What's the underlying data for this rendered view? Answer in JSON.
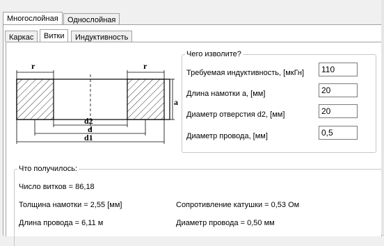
{
  "tabs_outer": [
    "Многослойная",
    "Однослойная"
  ],
  "tabs_inner": [
    "Каркас",
    "Витки",
    "Индуктивность"
  ],
  "input_group": {
    "legend": "Чего изволите?",
    "fields": [
      {
        "label": "Требуемая индуктивность, [мкГн]",
        "value": "110"
      },
      {
        "label": "Длина намотки a, [мм]",
        "value": "20"
      },
      {
        "label": "Диаметр отверстия d2, [мм]",
        "value": "20"
      },
      {
        "label": "Диаметр провода, [мм]",
        "value": "0,5"
      }
    ]
  },
  "diagram": {
    "labels": {
      "r_left": "r",
      "r_right": "r",
      "a": "a",
      "d2": "d2",
      "d": "d",
      "d1": "d1"
    }
  },
  "results": {
    "legend": "Что получилось:",
    "turns": "Число витков = 86,18",
    "thickness": "Толщина намотки = 2,55 [мм]",
    "resistance": "Сопротивление катушки = 0,53 Ом",
    "wire_length": "Длина провода = 6,11 м",
    "wire_diameter": "Диаметр провода = 0,50 мм"
  }
}
